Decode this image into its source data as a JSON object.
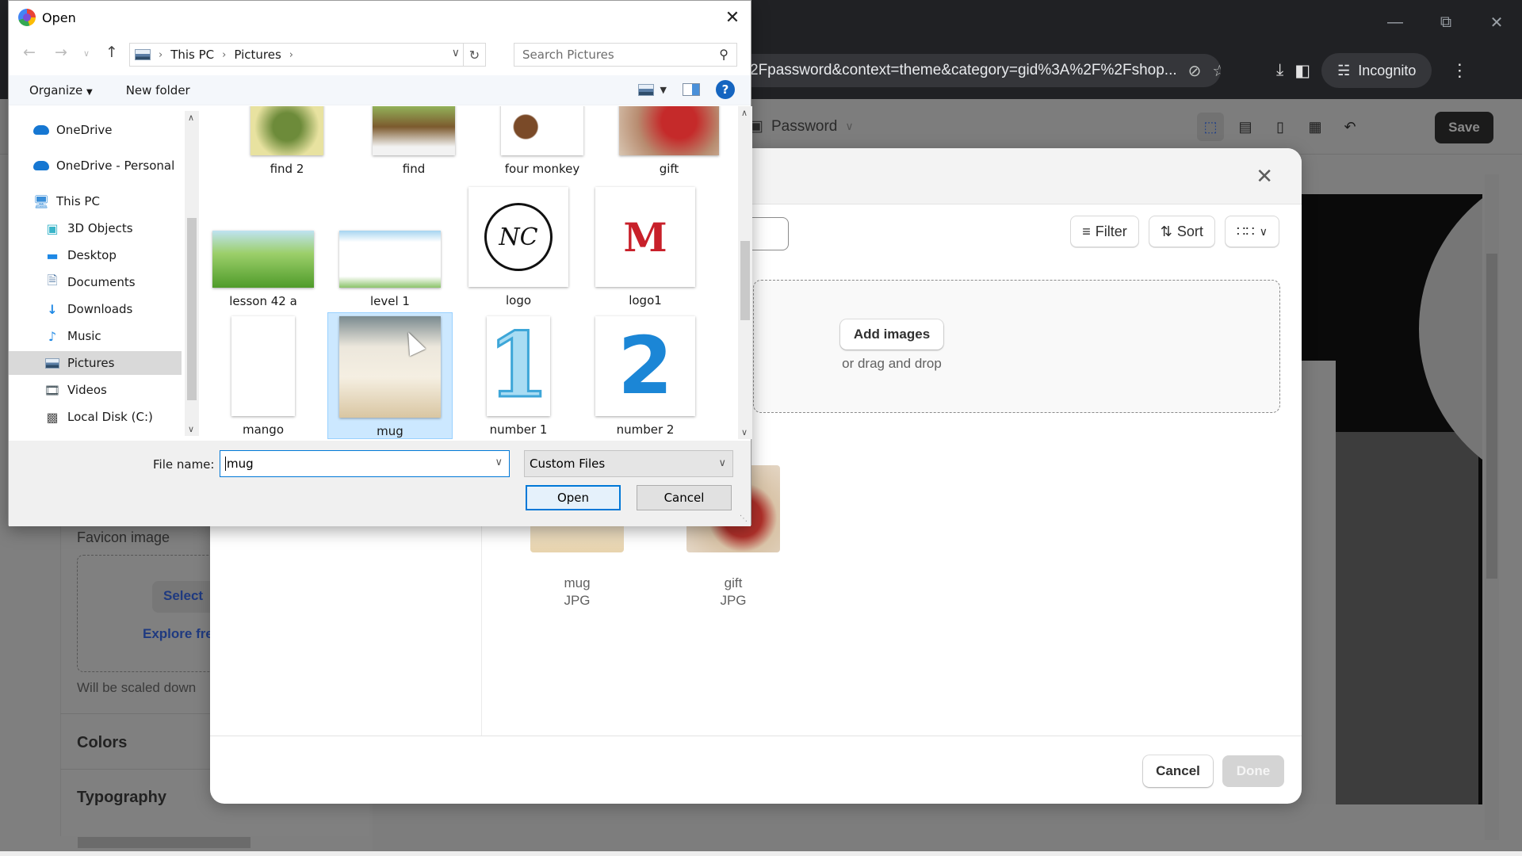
{
  "browser": {
    "address_text": "2Fpassword&context=theme&category=gid%3A%2F%2Fshop...",
    "incognito_label": "Incognito",
    "icons": [
      "eye-off-icon",
      "star-icon",
      "download-icon",
      "side-panel-icon",
      "incognito-icon",
      "kebab-menu-icon"
    ],
    "window_controls": [
      "minimize",
      "restore",
      "close"
    ]
  },
  "editor": {
    "template_select": "Password",
    "save_label": "Save",
    "tools": [
      "inspect-icon",
      "desktop-icon",
      "mobile-icon",
      "fullscreen-icon",
      "undo-icon"
    ],
    "left_panel": {
      "favicon_label": "Favicon image",
      "favicon_select": "Select",
      "favicon_explore": "Explore fre",
      "favicon_help": "Will be scaled down",
      "colors": "Colors",
      "typography": "Typography"
    }
  },
  "picker": {
    "filter_label": "Filter",
    "sort_label": "Sort",
    "add_images_label": "Add images",
    "drag_drop_text": "or drag and drop",
    "assets": [
      {
        "name": "mug",
        "type": "JPG"
      },
      {
        "name": "gift",
        "type": "JPG"
      }
    ],
    "cancel_label": "Cancel",
    "done_label": "Done"
  },
  "dialog": {
    "title": "Open",
    "breadcrumb": [
      "This PC",
      "Pictures"
    ],
    "search_placeholder": "Search Pictures",
    "organize_label": "Organize",
    "new_folder_label": "New folder",
    "nav": [
      {
        "label": "OneDrive",
        "icon": "cloud-icon",
        "level": "top"
      },
      {
        "label": "OneDrive - Personal",
        "icon": "cloud-icon",
        "level": "top"
      },
      {
        "label": "This PC",
        "icon": "computer-icon",
        "level": "top"
      },
      {
        "label": "3D Objects",
        "icon": "cube-icon",
        "level": "sub"
      },
      {
        "label": "Desktop",
        "icon": "desktop-folder-icon",
        "level": "sub"
      },
      {
        "label": "Documents",
        "icon": "documents-icon",
        "level": "sub"
      },
      {
        "label": "Downloads",
        "icon": "download-arrow-icon",
        "level": "sub"
      },
      {
        "label": "Music",
        "icon": "music-note-icon",
        "level": "sub"
      },
      {
        "label": "Pictures",
        "icon": "pictures-icon",
        "level": "sub",
        "selected": true
      },
      {
        "label": "Videos",
        "icon": "film-icon",
        "level": "sub"
      },
      {
        "label": "Local Disk (C:)",
        "icon": "drive-icon",
        "level": "sub"
      }
    ],
    "files": [
      {
        "name": "find 2"
      },
      {
        "name": "find"
      },
      {
        "name": "four monkey"
      },
      {
        "name": "gift"
      },
      {
        "name": "lesson 42 a"
      },
      {
        "name": "level 1"
      },
      {
        "name": "logo"
      },
      {
        "name": "logo1"
      },
      {
        "name": "mango"
      },
      {
        "name": "mug",
        "selected": true
      },
      {
        "name": "number 1"
      },
      {
        "name": "number 2"
      }
    ],
    "file_name_label": "File name:",
    "file_name_value": "mug",
    "file_type": "Custom Files",
    "open_label": "Open",
    "cancel_label": "Cancel"
  }
}
